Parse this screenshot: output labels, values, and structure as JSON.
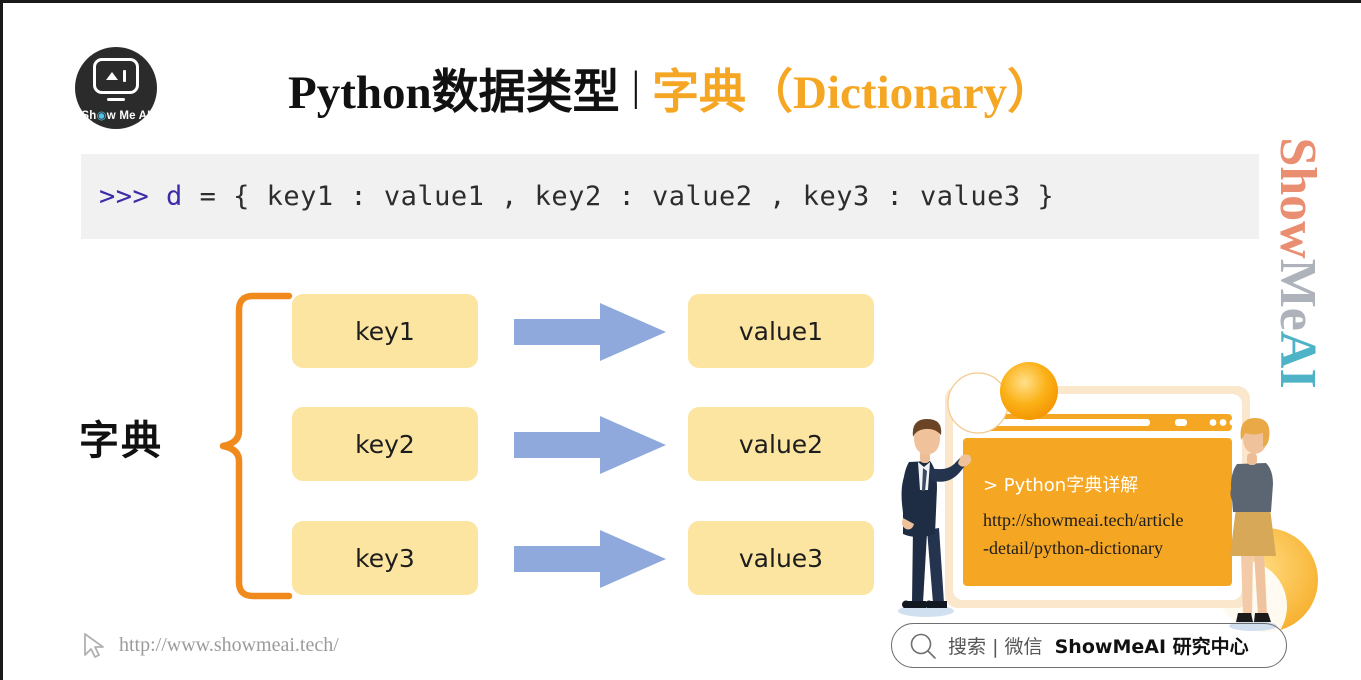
{
  "brand": {
    "logo_text": "Show Me AI",
    "logo_icon": "robot-face-icon",
    "watermark_part1": "Show",
    "watermark_part2": "Me",
    "watermark_part3": "AI",
    "color_orange": "#F5A623",
    "color_yellow_box": "#FCE5A1",
    "color_blue_arrow": "#8FA9DC",
    "color_code_bg": "#F1F1F1",
    "color_prompt": "#3B2CA8"
  },
  "header": {
    "title_black": "Python数据类型",
    "title_separator": "|",
    "title_orange": "字典（Dictionary）"
  },
  "code": {
    "prompt": ">>>",
    "variable": "d",
    "expression": " = { key1 : value1 , key2 : value2 , key3 : value3 }"
  },
  "diagram": {
    "label": "字典",
    "brace_icon": "curly-brace-icon",
    "rows": [
      {
        "key": "key1",
        "arrow_icon": "right-arrow-icon",
        "value": "value1"
      },
      {
        "key": "key2",
        "arrow_icon": "right-arrow-icon",
        "value": "value2"
      },
      {
        "key": "key3",
        "arrow_icon": "right-arrow-icon",
        "value": "value3"
      }
    ]
  },
  "illustration": {
    "browser_heading": "> Python字典详解",
    "browser_url_line1": "http://showmeai.tech/article",
    "browser_url_line2": "-detail/python-dictionary",
    "left_person": "man-pointing-illustration",
    "right_person": "woman-standing-illustration",
    "browser_window": "browser-window-illustration"
  },
  "footer": {
    "cursor_icon": "cursor-pointer-icon",
    "url": "http://www.showmeai.tech/",
    "search_icon": "magnifier-icon",
    "search_label": "搜索",
    "search_separator": "|",
    "search_channel": "微信",
    "search_account": "ShowMeAI 研究中心"
  }
}
